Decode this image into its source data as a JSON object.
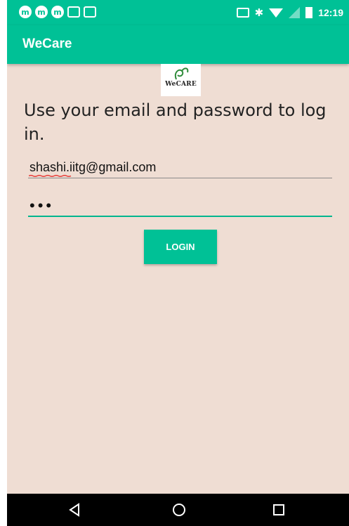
{
  "status_bar": {
    "time": "12:19",
    "icons": [
      "notification-icon",
      "notification-icon",
      "notification-icon",
      "shopping-bag-icon",
      "shopping-bag-icon",
      "cast-icon",
      "bluetooth-icon",
      "wifi-icon",
      "signal-icon",
      "battery-icon"
    ]
  },
  "app_bar": {
    "title": "WeCare"
  },
  "logo": {
    "text": "WeCARE"
  },
  "instructions": "Use your email and password to log in.",
  "email_field": {
    "value": "shashi.iitg@gmail.com"
  },
  "password_field": {
    "value": "•••"
  },
  "login_button": {
    "label": "LOGIN"
  },
  "colors": {
    "primary": "#00c196",
    "background": "#efddd3"
  }
}
